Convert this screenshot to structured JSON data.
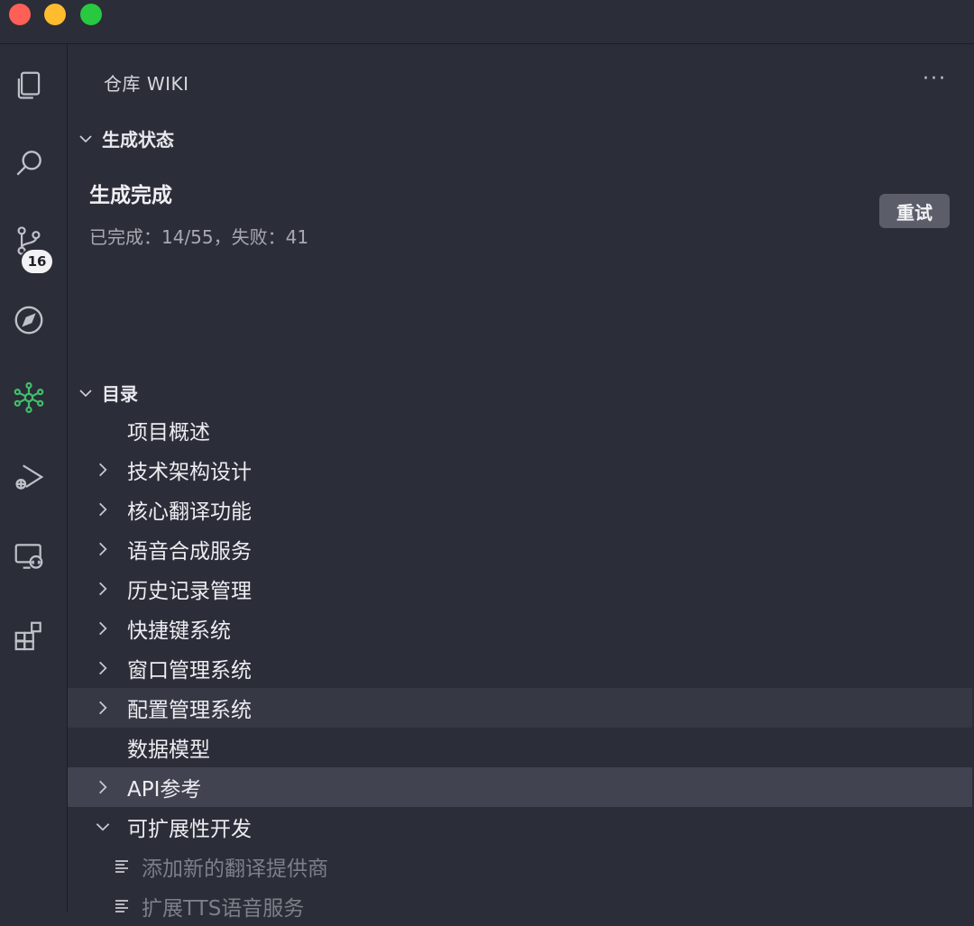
{
  "panel": {
    "title": "仓库 WIKI",
    "more_label": "···"
  },
  "activity": {
    "source_control_badge": "16",
    "active_color": "#3fbf6a"
  },
  "status_section": {
    "header": "生成状态",
    "title": "生成完成",
    "subtitle": "已完成：14/55，失败：41",
    "retry_label": "重试"
  },
  "toc": {
    "header": "目录",
    "items": [
      {
        "label": "项目概述",
        "chevron": "none"
      },
      {
        "label": "技术架构设计",
        "chevron": "right"
      },
      {
        "label": "核心翻译功能",
        "chevron": "right"
      },
      {
        "label": "语音合成服务",
        "chevron": "right"
      },
      {
        "label": "历史记录管理",
        "chevron": "right"
      },
      {
        "label": "快捷键系统",
        "chevron": "right"
      },
      {
        "label": "窗口管理系统",
        "chevron": "right"
      },
      {
        "label": "配置管理系统",
        "chevron": "right"
      },
      {
        "label": "数据模型",
        "chevron": "none"
      },
      {
        "label": "API参考",
        "chevron": "right"
      },
      {
        "label": "可扩展性开发",
        "chevron": "down"
      }
    ],
    "subitems": [
      {
        "label": "添加新的翻译提供商"
      },
      {
        "label": "扩展TTS语音服务"
      }
    ]
  }
}
